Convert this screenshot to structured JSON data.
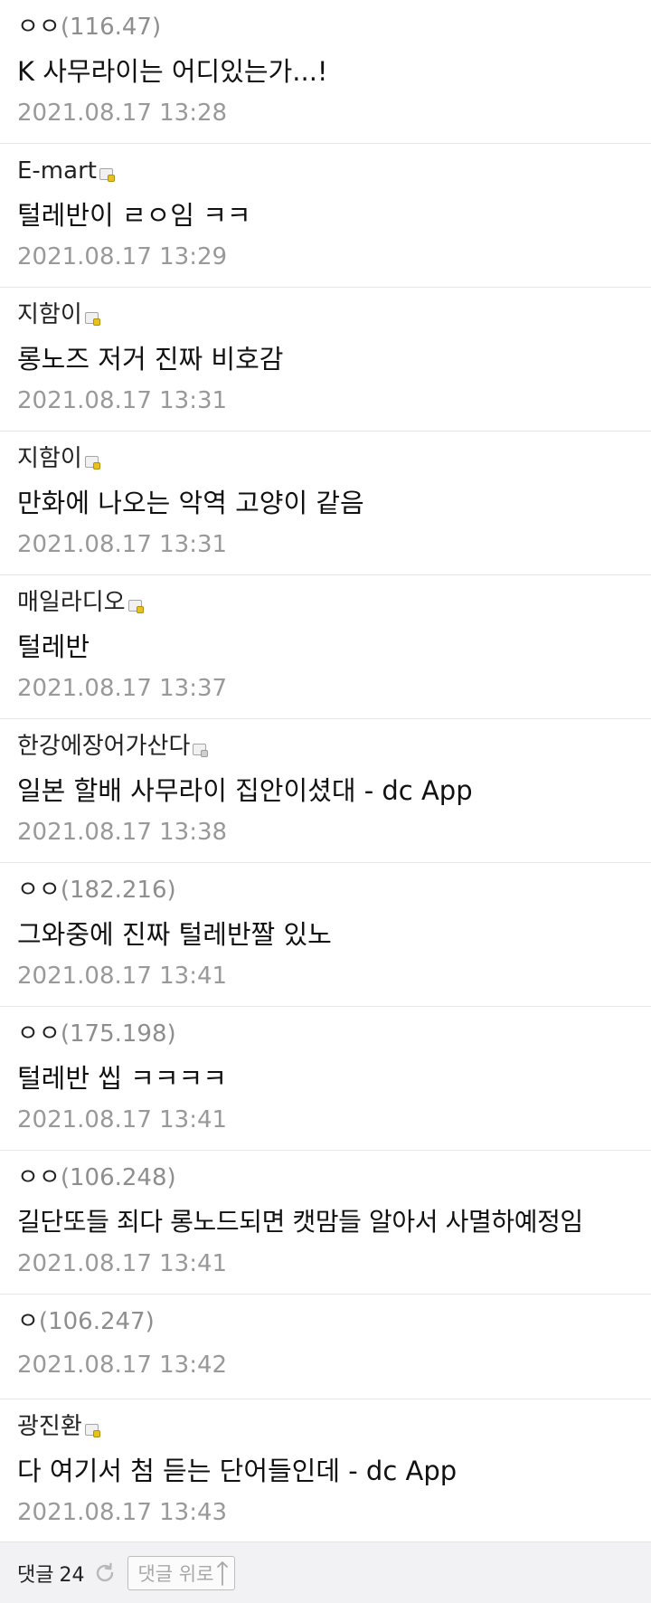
{
  "comments": [
    {
      "nickname": "ㅇㅇ",
      "ip": "(116.47)",
      "badge": "",
      "text": "K 사무라이는 어디있는가...!",
      "date": "2021.08.17 13:28"
    },
    {
      "nickname": "E-mart",
      "ip": "",
      "badge": "gallog-icon",
      "text": "털레반이 ㄹㅇ임 ㅋㅋ",
      "date": "2021.08.17 13:29"
    },
    {
      "nickname": "지함이",
      "ip": "",
      "badge": "gallog-icon",
      "text": "롱노즈 저거 진짜 비호감",
      "date": "2021.08.17 13:31"
    },
    {
      "nickname": "지함이",
      "ip": "",
      "badge": "gallog-icon",
      "text": "만화에 나오는 악역 고양이 같음",
      "date": "2021.08.17 13:31"
    },
    {
      "nickname": "매일라디오",
      "ip": "",
      "badge": "gallog-icon",
      "text": "털레반",
      "date": "2021.08.17 13:37"
    },
    {
      "nickname": "한강에장어가산다",
      "ip": "",
      "badge": "gallog-icon-gray",
      "text": "일본 할배 사무라이 집안이셨대 - dc App",
      "date": "2021.08.17 13:38"
    },
    {
      "nickname": "ㅇㅇ",
      "ip": "(182.216)",
      "badge": "",
      "text": "그와중에 진짜 털레반짤 있노",
      "date": "2021.08.17 13:41"
    },
    {
      "nickname": "ㅇㅇ",
      "ip": "(175.198)",
      "badge": "",
      "text": "털레반 씹 ㅋㅋㅋㅋ",
      "date": "2021.08.17 13:41"
    },
    {
      "nickname": "ㅇㅇ",
      "ip": "(106.248)",
      "badge": "",
      "text": "길단또들 죄다 롱노드되면 캣맘들 알아서 사멸하예정임",
      "date": "2021.08.17 13:41"
    },
    {
      "nickname": "ㅇ",
      "ip": "(106.247)",
      "badge": "",
      "text": "",
      "date": "2021.08.17 13:42"
    },
    {
      "nickname": "광진환",
      "ip": "",
      "badge": "gallog-icon",
      "text": "다 여기서 첨 듣는 단어들인데 - dc App",
      "date": "2021.08.17 13:43"
    }
  ],
  "footer": {
    "comment_label": "댓글",
    "comment_count": "24",
    "refresh_icon": "refresh-icon",
    "top_button_label": "댓글 위로",
    "top_button_icon": "arrow-up-icon"
  },
  "colors": {
    "nickname": "#222222",
    "ip": "#8e8e8e",
    "date": "#999999",
    "badge_gold": "#e8c21c",
    "footer_bg": "#f2f1f4"
  }
}
